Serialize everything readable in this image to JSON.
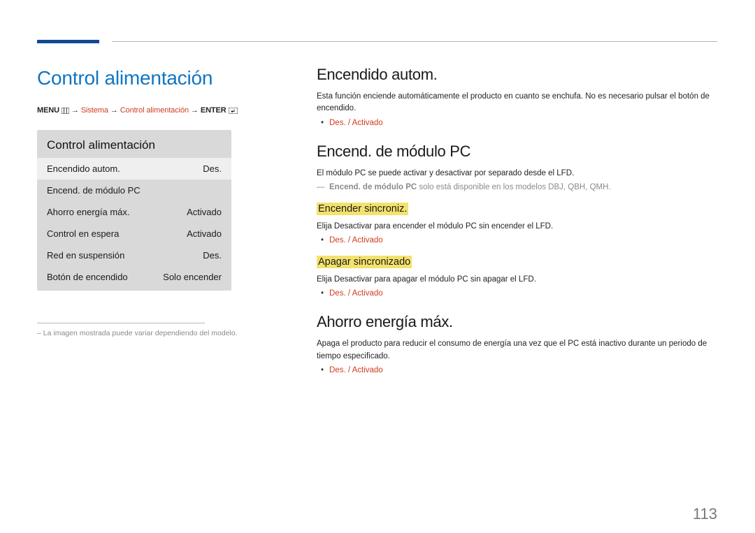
{
  "page_number": "113",
  "left": {
    "main_heading": "Control alimentación",
    "breadcrumb": {
      "menu_label": "MENU",
      "arrow": "→",
      "path1": "Sistema",
      "path2": "Control alimentación",
      "enter_label": "ENTER"
    },
    "panel_title": "Control alimentación",
    "rows": [
      {
        "label": "Encendido autom.",
        "value": "Des.",
        "highlight": true
      },
      {
        "label": "Encend. de módulo PC",
        "value": "",
        "highlight": false
      },
      {
        "label": "Ahorro energía máx.",
        "value": "Activado",
        "highlight": false
      },
      {
        "label": "Control en espera",
        "value": "Activado",
        "highlight": false
      },
      {
        "label": "Red en suspensión",
        "value": "Des.",
        "highlight": false
      },
      {
        "label": "Botón de encendido",
        "value": "Solo encender",
        "highlight": false
      }
    ],
    "footnote_prefix": "– ",
    "footnote": "La imagen mostrada puede variar dependiendo del modelo."
  },
  "right": {
    "sec1": {
      "heading": "Encendido autom.",
      "para": "Esta función enciende automáticamente el producto en cuanto se enchufa. No es necesario pulsar el botón de encendido.",
      "option": "Des. / Activado"
    },
    "sec2": {
      "heading": "Encend. de módulo PC",
      "para": "El módulo PC se puede activar y desactivar por separado desde el LFD.",
      "note_bold": "Encend. de módulo PC",
      "note_rest": " solo está disponible en los modelos DBJ, QBH, QMH.",
      "sub1": {
        "heading": "Encender sincroniz.",
        "para": "Elija Desactivar para encender el módulo PC sin encender el LFD.",
        "option": "Des. / Activado"
      },
      "sub2": {
        "heading": "Apagar sincronizado",
        "para": "Elija Desactivar para apagar el módulo PC sin apagar el LFD.",
        "option": "Des. / Activado"
      }
    },
    "sec3": {
      "heading": "Ahorro energía máx.",
      "para": "Apaga el producto para reducir el consumo de energía una vez que el PC está inactivo durante un periodo de tiempo especificado.",
      "option": "Des. / Activado"
    }
  }
}
